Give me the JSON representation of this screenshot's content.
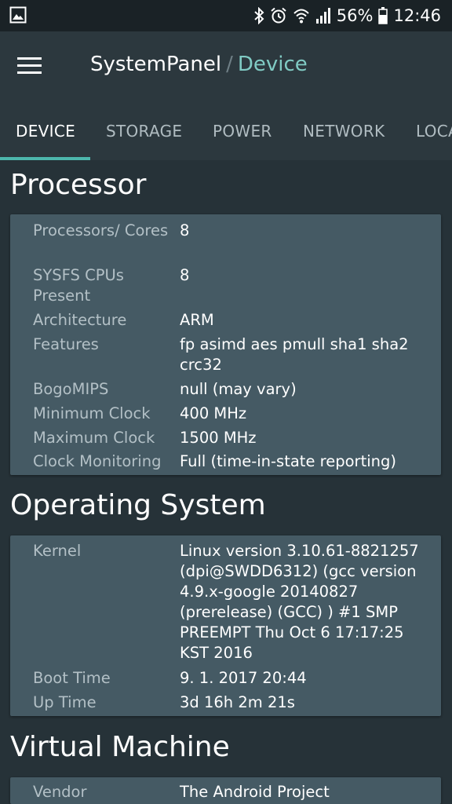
{
  "status_bar": {
    "battery_percent": "56%",
    "time": "12:46",
    "icons": [
      "image-icon",
      "bluetooth-icon",
      "alarm-icon",
      "wifi-icon",
      "signal-icon",
      "battery-icon"
    ]
  },
  "app_bar": {
    "app_name": "SystemPanel",
    "separator": "/",
    "page_name": "Device",
    "menu_icon": "hamburger-menu-icon"
  },
  "tabs": [
    {
      "label": "DEVICE",
      "active": true
    },
    {
      "label": "STORAGE",
      "active": false
    },
    {
      "label": "POWER",
      "active": false
    },
    {
      "label": "NETWORK",
      "active": false
    },
    {
      "label": "LOCA",
      "active": false
    }
  ],
  "sections": {
    "processor": {
      "title": "Processor",
      "rows": [
        {
          "label": "Processors/ Cores",
          "value": "8"
        },
        {
          "label": "SYSFS CPUs Present",
          "value": "8"
        },
        {
          "label": "Architecture",
          "value": "ARM"
        },
        {
          "label": "Features",
          "value": "fp asimd aes pmull sha1 sha2 crc32"
        },
        {
          "label": "BogoMIPS",
          "value": "null (may vary)"
        },
        {
          "label": "Minimum Clock",
          "value": "400 MHz"
        },
        {
          "label": "Maximum Clock",
          "value": "1500 MHz"
        },
        {
          "label": "Clock Monitoring",
          "value": "Full (time-in-state reporting)"
        }
      ]
    },
    "operating_system": {
      "title": "Operating System",
      "rows": [
        {
          "label": "Kernel",
          "value": "Linux version 3.10.61-8821257 (dpi@SWDD6312) (gcc version 4.9.x-google 20140827 (prerelease) (GCC) ) #1 SMP PREEMPT Thu Oct 6 17:17:25 KST 2016"
        },
        {
          "label": "Boot Time",
          "value": "9. 1. 2017 20:44"
        },
        {
          "label": "Up Time",
          "value": "3d 16h 2m 21s"
        }
      ]
    },
    "virtual_machine": {
      "title": "Virtual Machine",
      "rows": [
        {
          "label": "Vendor",
          "value": "The Android Project"
        }
      ]
    }
  },
  "colors": {
    "background": "#263238",
    "app_bar": "#2c383e",
    "card": "#455a64",
    "accent": "#4db6ac",
    "page_name": "#80cbc4",
    "label_text": "#b3c0c6"
  }
}
